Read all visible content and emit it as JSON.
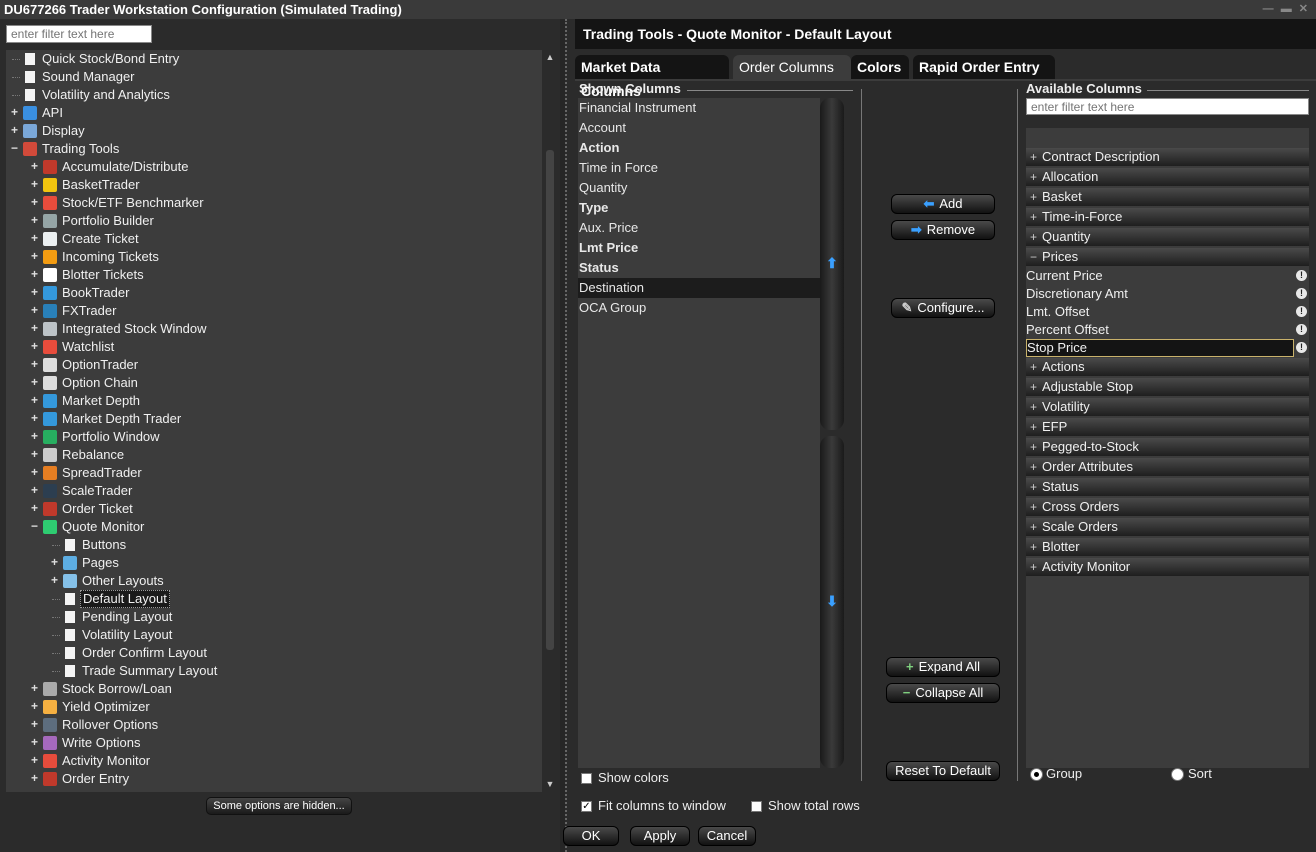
{
  "window": {
    "title": "DU677266 Trader Workstation Configuration (Simulated Trading)"
  },
  "left": {
    "filter_placeholder": "enter filter text here",
    "hidden_button": "Some options are hidden...",
    "tree": [
      {
        "label": "Quick Stock/Bond Entry",
        "level": 1,
        "icon": "doc",
        "tog": ""
      },
      {
        "label": "Sound Manager",
        "level": 1,
        "icon": "doc",
        "tog": ""
      },
      {
        "label": "Volatility and Analytics",
        "level": 1,
        "icon": "doc",
        "tog": ""
      },
      {
        "label": "API",
        "level": 1,
        "icon": "api",
        "tog": "+"
      },
      {
        "label": "Display",
        "level": 1,
        "icon": "display",
        "tog": "+"
      },
      {
        "label": "Trading Tools",
        "level": 1,
        "icon": "tools",
        "tog": "−"
      },
      {
        "label": "Accumulate/Distribute",
        "level": 2,
        "icon": "c1",
        "tog": "+"
      },
      {
        "label": "BasketTrader",
        "level": 2,
        "icon": "c2",
        "tog": "+"
      },
      {
        "label": "Stock/ETF Benchmarker",
        "level": 2,
        "icon": "c3",
        "tog": "+"
      },
      {
        "label": "Portfolio Builder",
        "level": 2,
        "icon": "c4",
        "tog": "+"
      },
      {
        "label": "Create Ticket",
        "level": 2,
        "icon": "c5",
        "tog": "+"
      },
      {
        "label": "Incoming Tickets",
        "level": 2,
        "icon": "c6",
        "tog": "+"
      },
      {
        "label": "Blotter Tickets",
        "level": 2,
        "icon": "c7",
        "tog": "+"
      },
      {
        "label": "BookTrader",
        "level": 2,
        "icon": "c8",
        "tog": "+"
      },
      {
        "label": "FXTrader",
        "level": 2,
        "icon": "c9",
        "tog": "+"
      },
      {
        "label": "Integrated Stock Window",
        "level": 2,
        "icon": "c10",
        "tog": "+"
      },
      {
        "label": "Watchlist",
        "level": 2,
        "icon": "c11",
        "tog": "+"
      },
      {
        "label": "OptionTrader",
        "level": 2,
        "icon": "c12",
        "tog": "+"
      },
      {
        "label": "Option Chain",
        "level": 2,
        "icon": "c12",
        "tog": "+"
      },
      {
        "label": "Market Depth",
        "level": 2,
        "icon": "c13",
        "tog": "+"
      },
      {
        "label": "Market Depth Trader",
        "level": 2,
        "icon": "c13",
        "tog": "+"
      },
      {
        "label": "Portfolio Window",
        "level": 2,
        "icon": "c14",
        "tog": "+"
      },
      {
        "label": "Rebalance",
        "level": 2,
        "icon": "c15",
        "tog": "+"
      },
      {
        "label": "SpreadTrader",
        "level": 2,
        "icon": "c16",
        "tog": "+"
      },
      {
        "label": "ScaleTrader",
        "level": 2,
        "icon": "c17",
        "tog": "+"
      },
      {
        "label": "Order Ticket",
        "level": 2,
        "icon": "c18",
        "tog": "+"
      },
      {
        "label": "Quote Monitor",
        "level": 2,
        "icon": "lynx",
        "tog": "−"
      },
      {
        "label": "Buttons",
        "level": 3,
        "icon": "doc",
        "tog": ""
      },
      {
        "label": "Pages",
        "level": 3,
        "icon": "c19",
        "tog": "+"
      },
      {
        "label": "Other Layouts",
        "level": 3,
        "icon": "c20",
        "tog": "+"
      },
      {
        "label": "Default Layout",
        "level": 3,
        "icon": "doc",
        "tog": "",
        "selected": true
      },
      {
        "label": "Pending Layout",
        "level": 3,
        "icon": "doc",
        "tog": ""
      },
      {
        "label": "Volatility Layout",
        "level": 3,
        "icon": "doc",
        "tog": ""
      },
      {
        "label": "Order Confirm Layout",
        "level": 3,
        "icon": "doc",
        "tog": ""
      },
      {
        "label": "Trade Summary Layout",
        "level": 3,
        "icon": "doc",
        "tog": ""
      },
      {
        "label": "Stock Borrow/Loan",
        "level": 2,
        "icon": "c21",
        "tog": "+"
      },
      {
        "label": "Yield Optimizer",
        "level": 2,
        "icon": "c22",
        "tog": "+"
      },
      {
        "label": "Rollover Options",
        "level": 2,
        "icon": "c23",
        "tog": "+"
      },
      {
        "label": "Write Options",
        "level": 2,
        "icon": "c24",
        "tog": "+"
      },
      {
        "label": "Activity Monitor",
        "level": 2,
        "icon": "c25",
        "tog": "+"
      },
      {
        "label": "Order Entry",
        "level": 2,
        "icon": "c18",
        "tog": "+"
      }
    ]
  },
  "right": {
    "panel_title": "Trading Tools - Quote Monitor - Default Layout",
    "tabs": [
      "Market Data Columns",
      "Order Columns",
      "Colors",
      "Rapid Order Entry"
    ],
    "shown_title": "Shown Columns",
    "available_title": "Available Columns",
    "available_filter_placeholder": "enter filter text here",
    "shown_columns": [
      {
        "label": "Financial Instrument",
        "bold": false
      },
      {
        "label": "Account",
        "bold": false
      },
      {
        "label": "Action",
        "bold": true
      },
      {
        "label": "Time in Force",
        "bold": false
      },
      {
        "label": "Quantity",
        "bold": false
      },
      {
        "label": "Type",
        "bold": true
      },
      {
        "label": "Aux. Price",
        "bold": false
      },
      {
        "label": "Lmt Price",
        "bold": true
      },
      {
        "label": "Status",
        "bold": true
      },
      {
        "label": "Destination",
        "bold": false,
        "selected": true
      },
      {
        "label": "OCA Group",
        "bold": false
      }
    ],
    "buttons": {
      "add": "Add",
      "remove": "Remove",
      "configure": "Configure...",
      "expand_all": "Expand All",
      "collapse_all": "Collapse All",
      "reset": "Reset To Default"
    },
    "available": [
      {
        "type": "group",
        "label": "Contract Description",
        "sign": "+"
      },
      {
        "type": "group",
        "label": "Allocation",
        "sign": "+"
      },
      {
        "type": "group",
        "label": "Basket",
        "sign": "+"
      },
      {
        "type": "group",
        "label": "Time-in-Force",
        "sign": "+"
      },
      {
        "type": "group",
        "label": "Quantity",
        "sign": "+"
      },
      {
        "type": "group",
        "label": "Prices",
        "sign": "−"
      },
      {
        "type": "item",
        "label": "Current Price"
      },
      {
        "type": "item",
        "label": "Discretionary Amt"
      },
      {
        "type": "item",
        "label": "Lmt. Offset"
      },
      {
        "type": "item",
        "label": "Percent Offset"
      },
      {
        "type": "item",
        "label": "Stop Price",
        "selected": true
      },
      {
        "type": "group",
        "label": "Actions",
        "sign": "+"
      },
      {
        "type": "group",
        "label": "Adjustable Stop",
        "sign": "+"
      },
      {
        "type": "group",
        "label": "Volatility",
        "sign": "+"
      },
      {
        "type": "group",
        "label": "EFP",
        "sign": "+"
      },
      {
        "type": "group",
        "label": "Pegged-to-Stock",
        "sign": "+"
      },
      {
        "type": "group",
        "label": "Order Attributes",
        "sign": "+"
      },
      {
        "type": "group",
        "label": "Status",
        "sign": "+"
      },
      {
        "type": "group",
        "label": "Cross Orders",
        "sign": "+"
      },
      {
        "type": "group",
        "label": "Scale Orders",
        "sign": "+"
      },
      {
        "type": "group",
        "label": "Blotter",
        "sign": "+"
      },
      {
        "type": "group",
        "label": "Activity Monitor",
        "sign": "+"
      }
    ],
    "show_colors": "Show colors",
    "fit_columns": "Fit columns to window",
    "show_total_rows": "Show total rows",
    "group_label": "Group",
    "sort_label": "Sort",
    "ok": "OK",
    "apply": "Apply",
    "cancel": "Cancel"
  },
  "colors": {
    "accent": "#3aa0ff",
    "bg": "#2b2b2b",
    "list_bg": "#3c3c3c"
  }
}
